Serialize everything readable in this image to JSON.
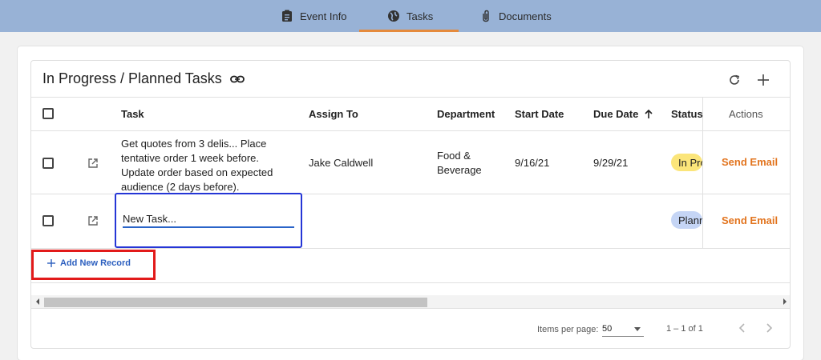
{
  "tabs": [
    {
      "label": "Event Info",
      "icon": "clipboard-icon"
    },
    {
      "label": "Tasks",
      "icon": "globe-icon",
      "active": true
    },
    {
      "label": "Documents",
      "icon": "paperclip-icon"
    }
  ],
  "card": {
    "title": "In Progress / Planned Tasks",
    "link_icon": "link-icon",
    "refresh_icon": "refresh-icon",
    "add_icon": "plus-icon"
  },
  "table": {
    "headers": {
      "task": "Task",
      "assign_to": "Assign To",
      "department": "Department",
      "start_date": "Start Date",
      "due_date": "Due Date",
      "status": "Status",
      "actions": "Actions"
    },
    "sort_icon": "arrow-up-icon",
    "rows": [
      {
        "task": "Get quotes from 3 delis... Place tentative order 1 week before. Update order based on expected audience (2 days before).",
        "assign_to": "Jake Caldwell",
        "department": "Food & Beverage",
        "start_date": "9/16/21",
        "due_date": "9/29/21",
        "status": "In Progress",
        "status_color": "#fbe57a",
        "action": "Send Email"
      },
      {
        "task_input_value": "New Task...",
        "assign_to": "",
        "department": "",
        "start_date": "",
        "due_date": "",
        "status": "Planned",
        "status_color": "#c5d5f5",
        "action": "Send Email"
      }
    ]
  },
  "add_record": {
    "label": "Add New Record",
    "icon": "plus-icon"
  },
  "pagination": {
    "items_per_page_label": "Items per page:",
    "page_size": "50",
    "range": "1 – 1 of 1"
  },
  "colors": {
    "topbar": "#98b2d6",
    "accent_orange": "#e2741e",
    "link_blue": "#2c5fbf",
    "highlight_red": "#e21a1a"
  }
}
